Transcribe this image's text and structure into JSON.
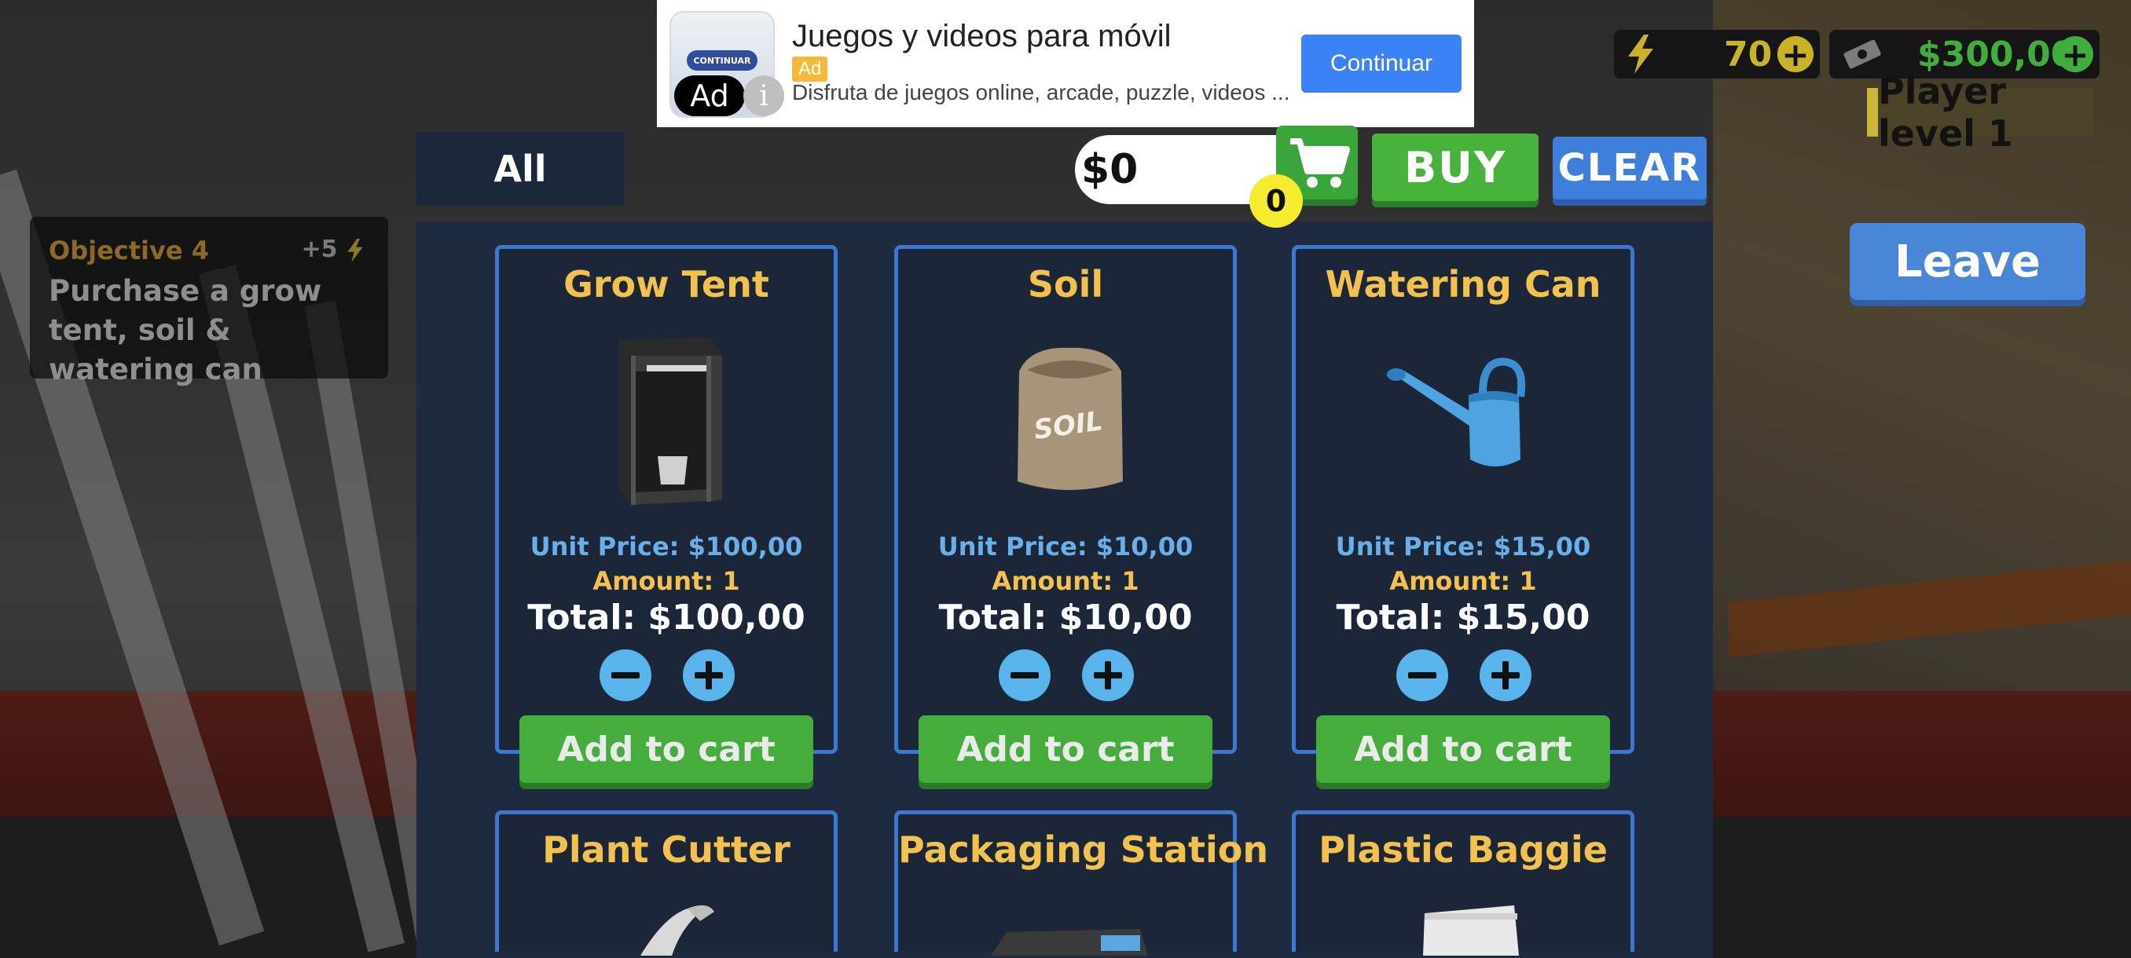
{
  "ad": {
    "title": "Juegos y videos para móvil",
    "tag": "Ad",
    "badge": "Ad",
    "info_icon": "i",
    "description": "Disfruta de juegos online, arcade, puzzle, videos ...",
    "cta": "Continuar",
    "thumb_label": "CONTINUAR"
  },
  "hud": {
    "energy": "70",
    "money": "$300,00",
    "player_level": "Player level 1",
    "plus_symbol": "+",
    "colors": {
      "energy": "#c9b225",
      "money": "#3fae3f"
    }
  },
  "objective": {
    "heading": "Objective 4",
    "reward": "+5",
    "text": "Purchase a grow tent, soil & watering can"
  },
  "shop": {
    "filter_tab": "All",
    "cart_total": "$0",
    "cart_count": "0",
    "buy_label": "BUY",
    "clear_label": "CLEAR",
    "leave_label": "Leave",
    "items": [
      {
        "name": "Grow Tent",
        "unit_price": "Unit Price: $100,00",
        "amount": "Amount: 1",
        "total": "Total: $100,00",
        "add_label": "Add to cart"
      },
      {
        "name": "Soil",
        "unit_price": "Unit Price: $10,00",
        "amount": "Amount: 1",
        "total": "Total: $10,00",
        "add_label": "Add to cart"
      },
      {
        "name": "Watering Can",
        "unit_price": "Unit Price: $15,00",
        "amount": "Amount: 1",
        "total": "Total: $15,00",
        "add_label": "Add to cart"
      },
      {
        "name": "Plant Cutter"
      },
      {
        "name": "Packaging Station"
      },
      {
        "name": "Plastic Baggie"
      }
    ],
    "soil_bag_label": "SOIL"
  }
}
